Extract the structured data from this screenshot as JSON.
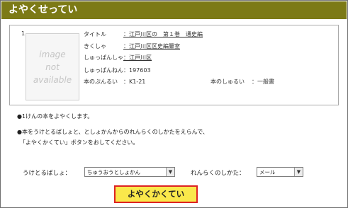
{
  "titlebar": {
    "title": "よやくせってい"
  },
  "book": {
    "number": "1",
    "thumbnail_text": [
      "image",
      "not",
      "available"
    ],
    "fields": [
      {
        "label": "タイトル",
        "value": "：江戸川区の　第１巻　通史編",
        "link": true
      },
      {
        "label": "きくしゃ",
        "value": "：江戸川区区史編纂室",
        "link": true
      },
      {
        "label": "しゅっぱんしゃ",
        "value": "：江戸川区",
        "link": true
      },
      {
        "label": "しゅっぱんねん",
        "value": "：197603",
        "link": false
      },
      {
        "label": "本のぶんるい",
        "value": "：K1-21",
        "link": false
      }
    ],
    "extra_field": {
      "label": "本のしゅるい",
      "value": "：一般書"
    }
  },
  "notes": [
    "●1けんの本をよやくします。",
    "●本をうけとるばしょと、としょかんからのれんらくのしかたをえらんで、",
    "「よやくかくてい」ボタンをおしてください。"
  ],
  "form": {
    "pickup_label": "うけとるばしょ：",
    "pickup_value": "ちゅうおうとしょかん",
    "contact_label": "れんらくのしかた：",
    "contact_value": "メール"
  },
  "submit_label": "よやくかくてい"
}
